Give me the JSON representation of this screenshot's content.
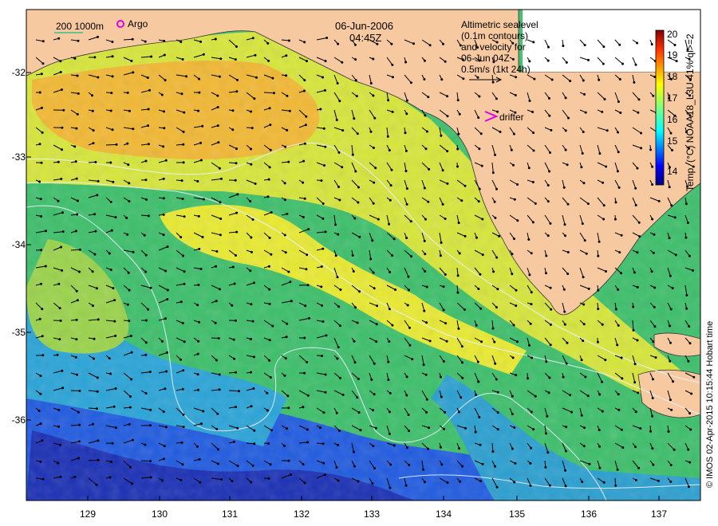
{
  "map": {
    "date_line1": "06-Jun-2006",
    "date_line2": "04:45Z",
    "scale_label": "200  1000m",
    "argo_label": "Argo",
    "drifter_label": "drifter",
    "sealevel_note": [
      "Altimetric sealevel",
      "(0.1m contours)",
      "and velocity for",
      "06-Jun 04Z",
      "0.5m/s (1kt 24h)"
    ],
    "credit": "© IMOS 02-Apr-2015 10:15:44 Hobart time",
    "lat_ticks": [
      "-32",
      "-33",
      "-34",
      "-35",
      "-36"
    ],
    "lon_ticks": [
      "129",
      "130",
      "131",
      "132",
      "133",
      "134",
      "135",
      "136",
      "137"
    ]
  },
  "colorbar": {
    "label": "Temp. (°C) NOAA18_L3U 41% ql>=2",
    "ticks": [
      "20",
      "19",
      "18",
      "17",
      "16",
      "15",
      "14"
    ],
    "colors": [
      "#00007f",
      "#0000ff",
      "#007fff",
      "#00ffff",
      "#7fff7f",
      "#ffff00",
      "#ff7f00",
      "#ff0000",
      "#7f0000"
    ]
  },
  "colors": {
    "land": "#f7c9a0",
    "warm": "#f0b020",
    "mid": "#22bb55",
    "cool": "#1a40c0"
  }
}
